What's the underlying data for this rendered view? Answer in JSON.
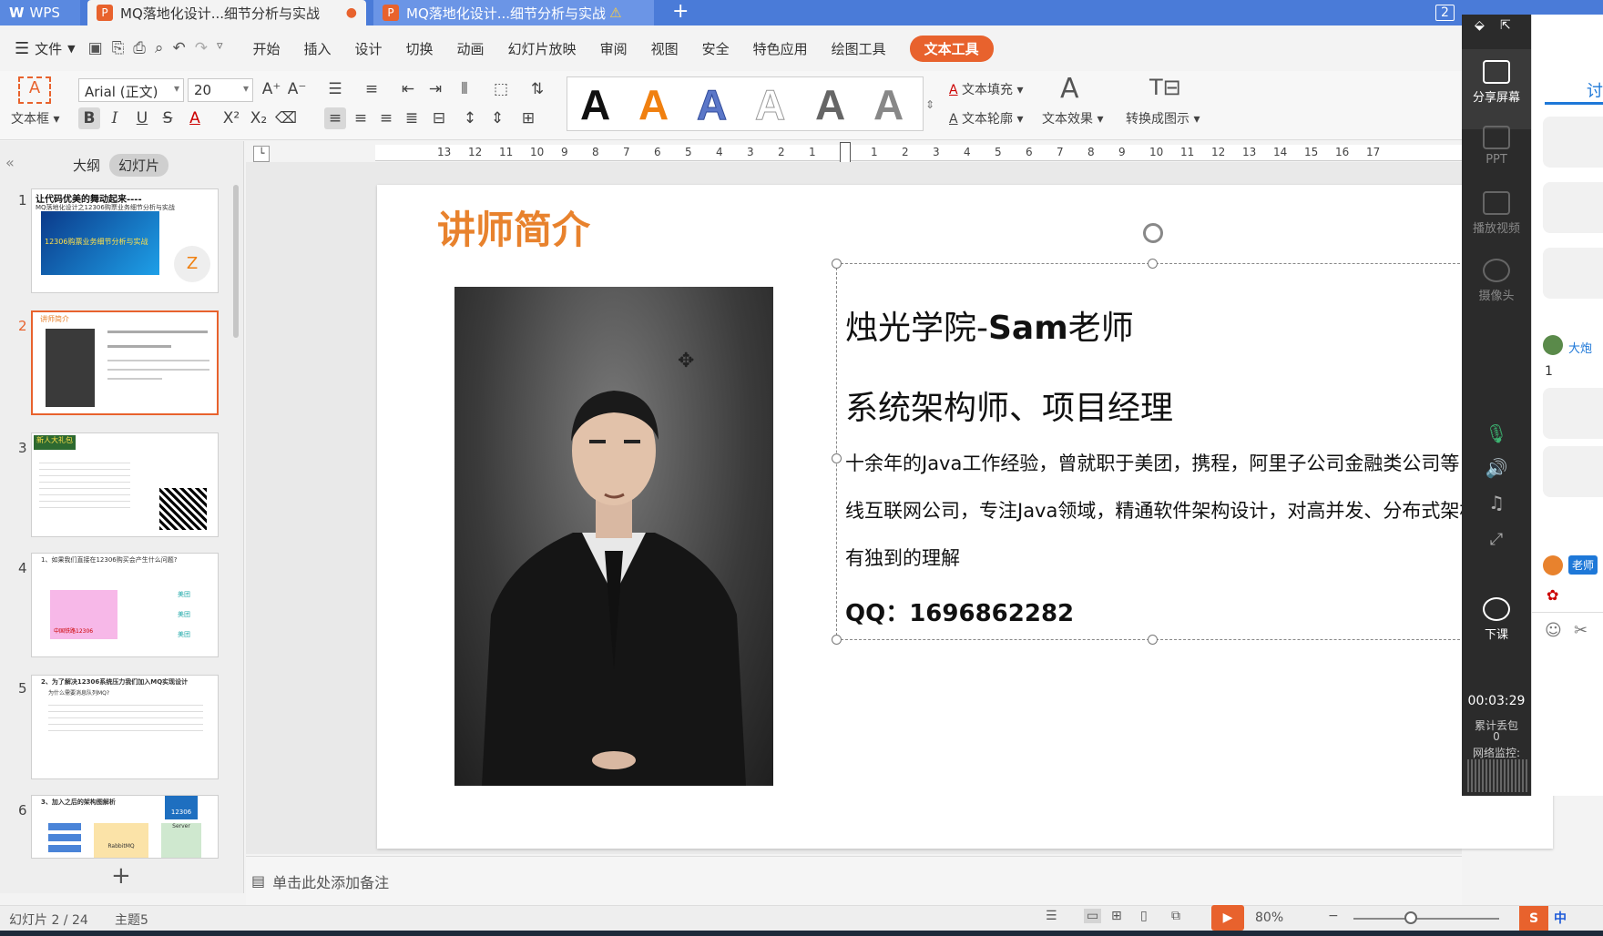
{
  "titlebar": {
    "wps_tab": "WPS",
    "doc_tab_1": "MQ落地化设计...细节分析与实战",
    "doc_tab_2": "MQ落地化设计...细节分析与实战",
    "window_count": "2"
  },
  "menu": {
    "file": "文件",
    "items": [
      "开始",
      "插入",
      "设计",
      "切换",
      "动画",
      "幻灯片放映",
      "审阅",
      "视图",
      "安全",
      "特色应用",
      "绘图工具"
    ],
    "active": "文本工具"
  },
  "ribbon": {
    "textbox_label": "文本框",
    "font_name": "Arial (正文)",
    "font_size": "20",
    "text_fill": "文本填充",
    "text_outline": "文本轮廓",
    "text_effect": "文本效果",
    "convert_graphic": "转换成图示",
    "style_samples": [
      "A",
      "A",
      "A",
      "A",
      "A",
      "A"
    ]
  },
  "left_panel": {
    "tab_outline": "大纲",
    "tab_slides": "幻灯片",
    "slide_numbers": [
      "1",
      "2",
      "3",
      "4",
      "5",
      "6"
    ],
    "thumb1_title": "让代码优美的舞动起来----",
    "thumb1_sub": "MQ落地化设计之12306购票业务细节分析与实战",
    "thumb1_banner": "12306购票业务细节分析与实战",
    "thumb2_title": "讲师简介",
    "thumb3_title": "新人大礼包",
    "thumb4_title": "1、如果我们直接在12306购买会产生什么问题?",
    "thumb4_logo": "中国铁路12306",
    "thumb4_tags": [
      "美团",
      "美团",
      "美团"
    ],
    "thumb5_title": "2、为了解决12306系统压力我们加入MQ实现设计",
    "thumb5_sub": "为什么需要消息队列MQ?",
    "thumb6_title": "3、加入之后的架构图解析",
    "thumb6_labels": [
      "RabbitMQ",
      "Server"
    ],
    "thumb6_logo": "12306",
    "add_button": "+"
  },
  "slide": {
    "title": "讲师简介",
    "name_prefix": "烛光学院-",
    "name_bold": "Sam",
    "name_suffix": "老师",
    "role": "系统架构师、项目经理",
    "bio_line1": "十余年的Java工作经验，曾就职于美团，携程，阿里子公司金融类公司等",
    "bio_line2": "线互联网公司，专注Java领域，精通软件架构设计，对高并发、分布式架构",
    "bio_line3": "有独到的理解",
    "qq_label": "QQ：",
    "qq_value": "1696862282"
  },
  "notes": {
    "placeholder": "单击此处添加备注"
  },
  "status": {
    "slide_info": "幻灯片 2 / 24",
    "theme": "主题5",
    "zoom": "80%"
  },
  "share_panel": {
    "share_screen": "分享屏幕",
    "ppt": "PPT",
    "play_video": "播放视频",
    "camera": "摄像头",
    "end_class": "下课",
    "timer": "00:03:29",
    "packet_loss_label": "累计丢包",
    "packet_loss_value": "0",
    "network_label": "网络监控:"
  },
  "chat": {
    "tab": "讨",
    "user1": "大炮",
    "msg1": "1",
    "user2": "老师"
  },
  "ime": {
    "label": "中"
  }
}
